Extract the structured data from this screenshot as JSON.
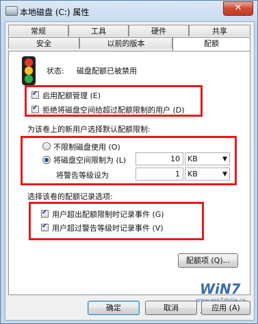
{
  "window": {
    "title": "本地磁盘 (C:) 属性",
    "close": "✕"
  },
  "tabs_row1": [
    "常规",
    "工具",
    "硬件",
    "共享"
  ],
  "tabs_row2": [
    "安全",
    "以前的版本",
    "配额"
  ],
  "status": {
    "label": "状态:",
    "value": "磁盘配额已被禁用"
  },
  "options": {
    "enable_quota": "启用配额管理 (E)",
    "deny_space": "拒绝将磁盘空间给超过配额限制的用户 (D)"
  },
  "default_limit": {
    "heading": "为该卷上的新用户选择默认配额限制:",
    "no_limit": "不限制磁盘使用 (O)",
    "limit_to": "将磁盘空间限制为 (L)",
    "limit_value": "10",
    "limit_unit": "KB",
    "warning_label": "将警告等级设为",
    "warning_value": "1",
    "warning_unit": "KB"
  },
  "logging": {
    "heading": "选择该卷的配额记录选项:",
    "log_limit": "用户超出配额限制时记录事件 (G)",
    "log_warning": "用户超过警告等级时记录事件 (V)"
  },
  "buttons": {
    "entries": "配额项 (Q)...",
    "ok": "确定",
    "cancel": "取消",
    "apply": "应用 (A)"
  },
  "watermark": {
    "logo": "WiN7 家",
    "url": "www.win7zhijia.cn"
  },
  "colors": {
    "highlight_box": "#e41a1a",
    "close_button": "#c03b22"
  }
}
